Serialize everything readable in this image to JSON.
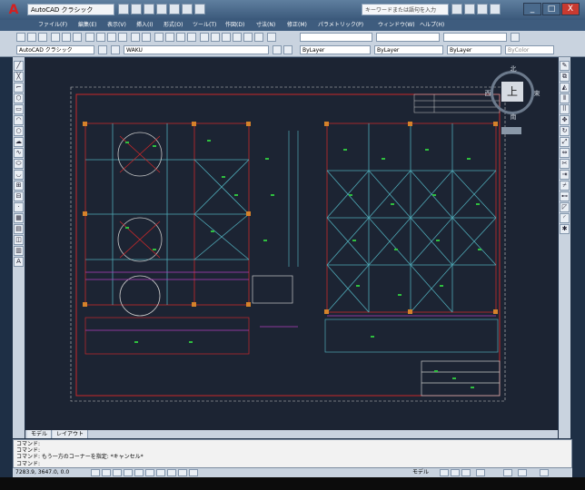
{
  "titlebar": {
    "workspace": "AutoCAD クラシック",
    "search_placeholder": "キーワードまたは語句を入力",
    "minimize": "_",
    "maximize": "□",
    "close": "X"
  },
  "menubar": {
    "items": [
      "ファイル(F)",
      "編集(E)",
      "表示(V)",
      "挿入(I)",
      "形式(O)",
      "ツール(T)",
      "作図(D)",
      "寸法(N)",
      "修正(M)",
      "パラメトリック(P)",
      "ウィンドウ(W)",
      "ヘルプ(H)"
    ]
  },
  "toolbar2": {
    "workspace": "AutoCAD クラシック",
    "layer": "WAKU",
    "color": "ByLayer",
    "linetype": "ByLayer",
    "lineweight": "ByLayer",
    "plotstyle": "ByColor"
  },
  "viewcube": {
    "face": "上",
    "north": "北",
    "south": "南",
    "east": "東",
    "west": "西"
  },
  "layout_tabs": [
    "モデル",
    "レイアウト"
  ],
  "command": {
    "line1": "コマンド:",
    "line2": "コマンド:",
    "line3": "コマンド:  もう一方のコーナーを指定: *キャンセル*",
    "prompt": "コマンド:"
  },
  "status": {
    "coordinates": "7283.9, 3647.0, 0.0",
    "model_label": "モデル"
  },
  "icons": {
    "app": "autocad-logo",
    "close": "close-icon",
    "search": "search-icon"
  },
  "colors": {
    "drawing_bg": "#1c2433",
    "frame_red": "#c8282a",
    "green_mark": "#2fbf3f",
    "cyan_line": "#4fa9b6",
    "magenta": "#b23fbf"
  }
}
